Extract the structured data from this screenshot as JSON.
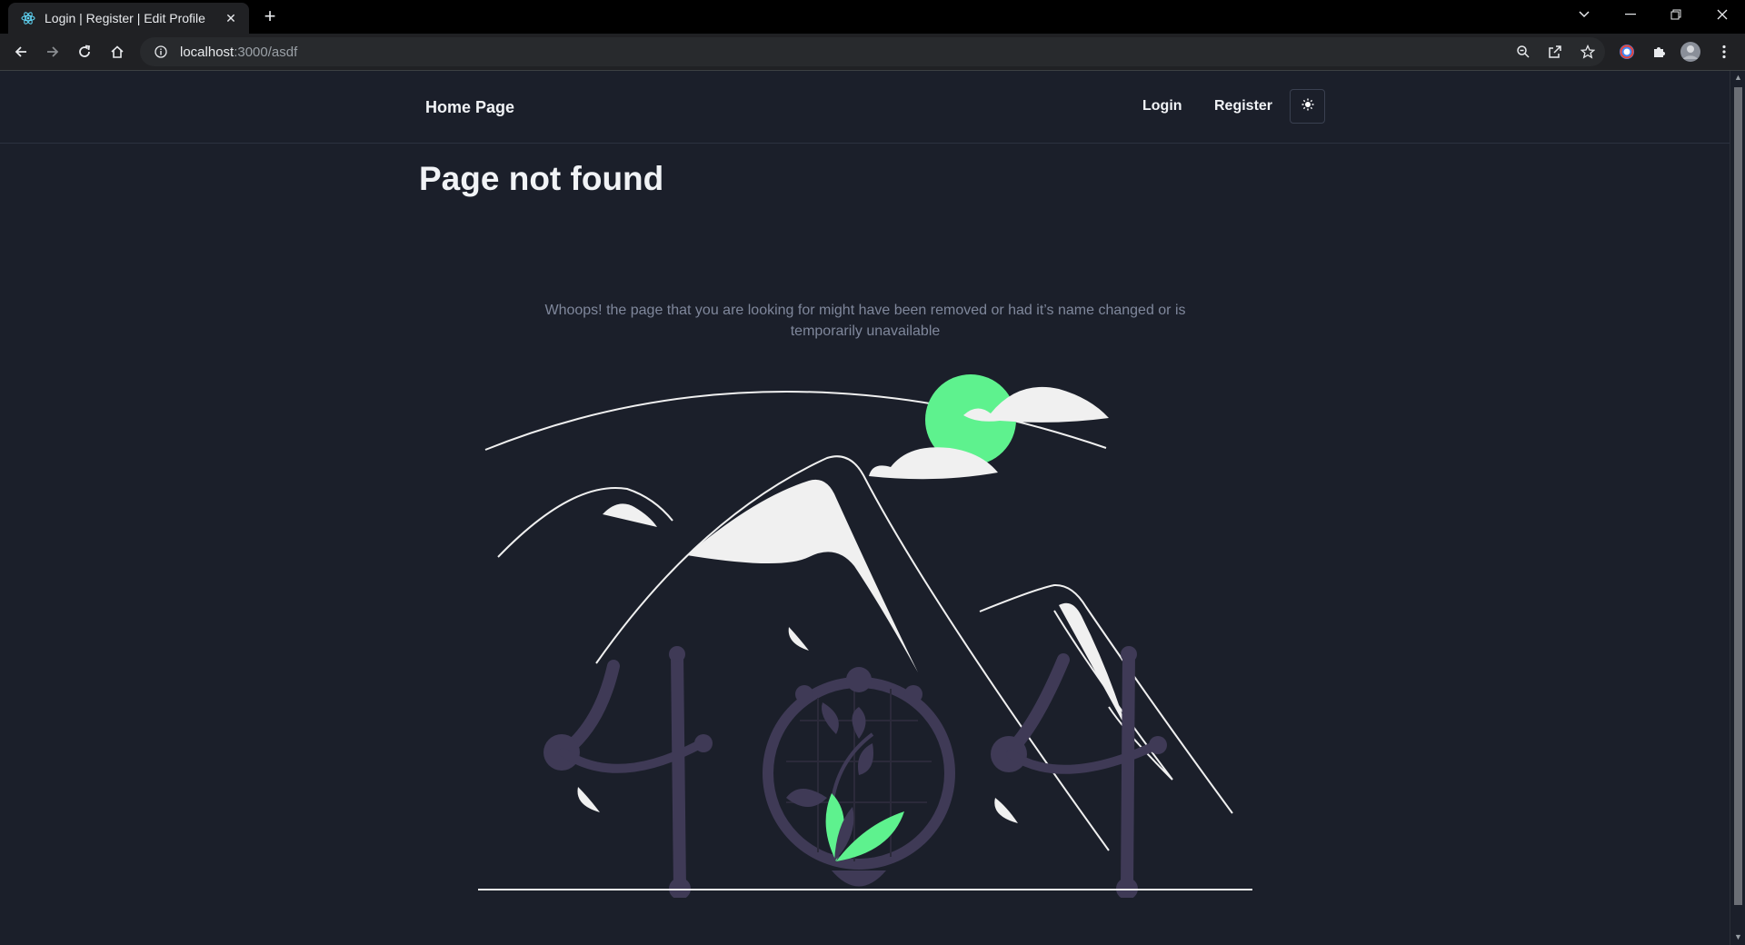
{
  "browser": {
    "tab_title": "Login | Register | Edit Profile",
    "new_tab": "+",
    "url_host": "localhost",
    "url_path": ":3000/asdf"
  },
  "navbar": {
    "brand": "Home Page",
    "login": "Login",
    "register": "Register"
  },
  "page": {
    "title": "Page not found",
    "message": "Whoops! the page that you are looking for might have been removed or had it’s name changed or is temporarily unavailable"
  },
  "colors": {
    "background": "#1b1f2a",
    "accent_green": "#5ef28e",
    "figure_purple": "#3f3a56",
    "cloud_white": "#f0f0f0"
  },
  "icons": [
    "react-icon",
    "close-icon",
    "back-icon",
    "forward-icon",
    "reload-icon",
    "home-icon",
    "info-icon",
    "zoom-icon",
    "share-icon",
    "star-icon",
    "extensions-icon",
    "profile-avatar",
    "menu-icon",
    "sun-icon"
  ]
}
